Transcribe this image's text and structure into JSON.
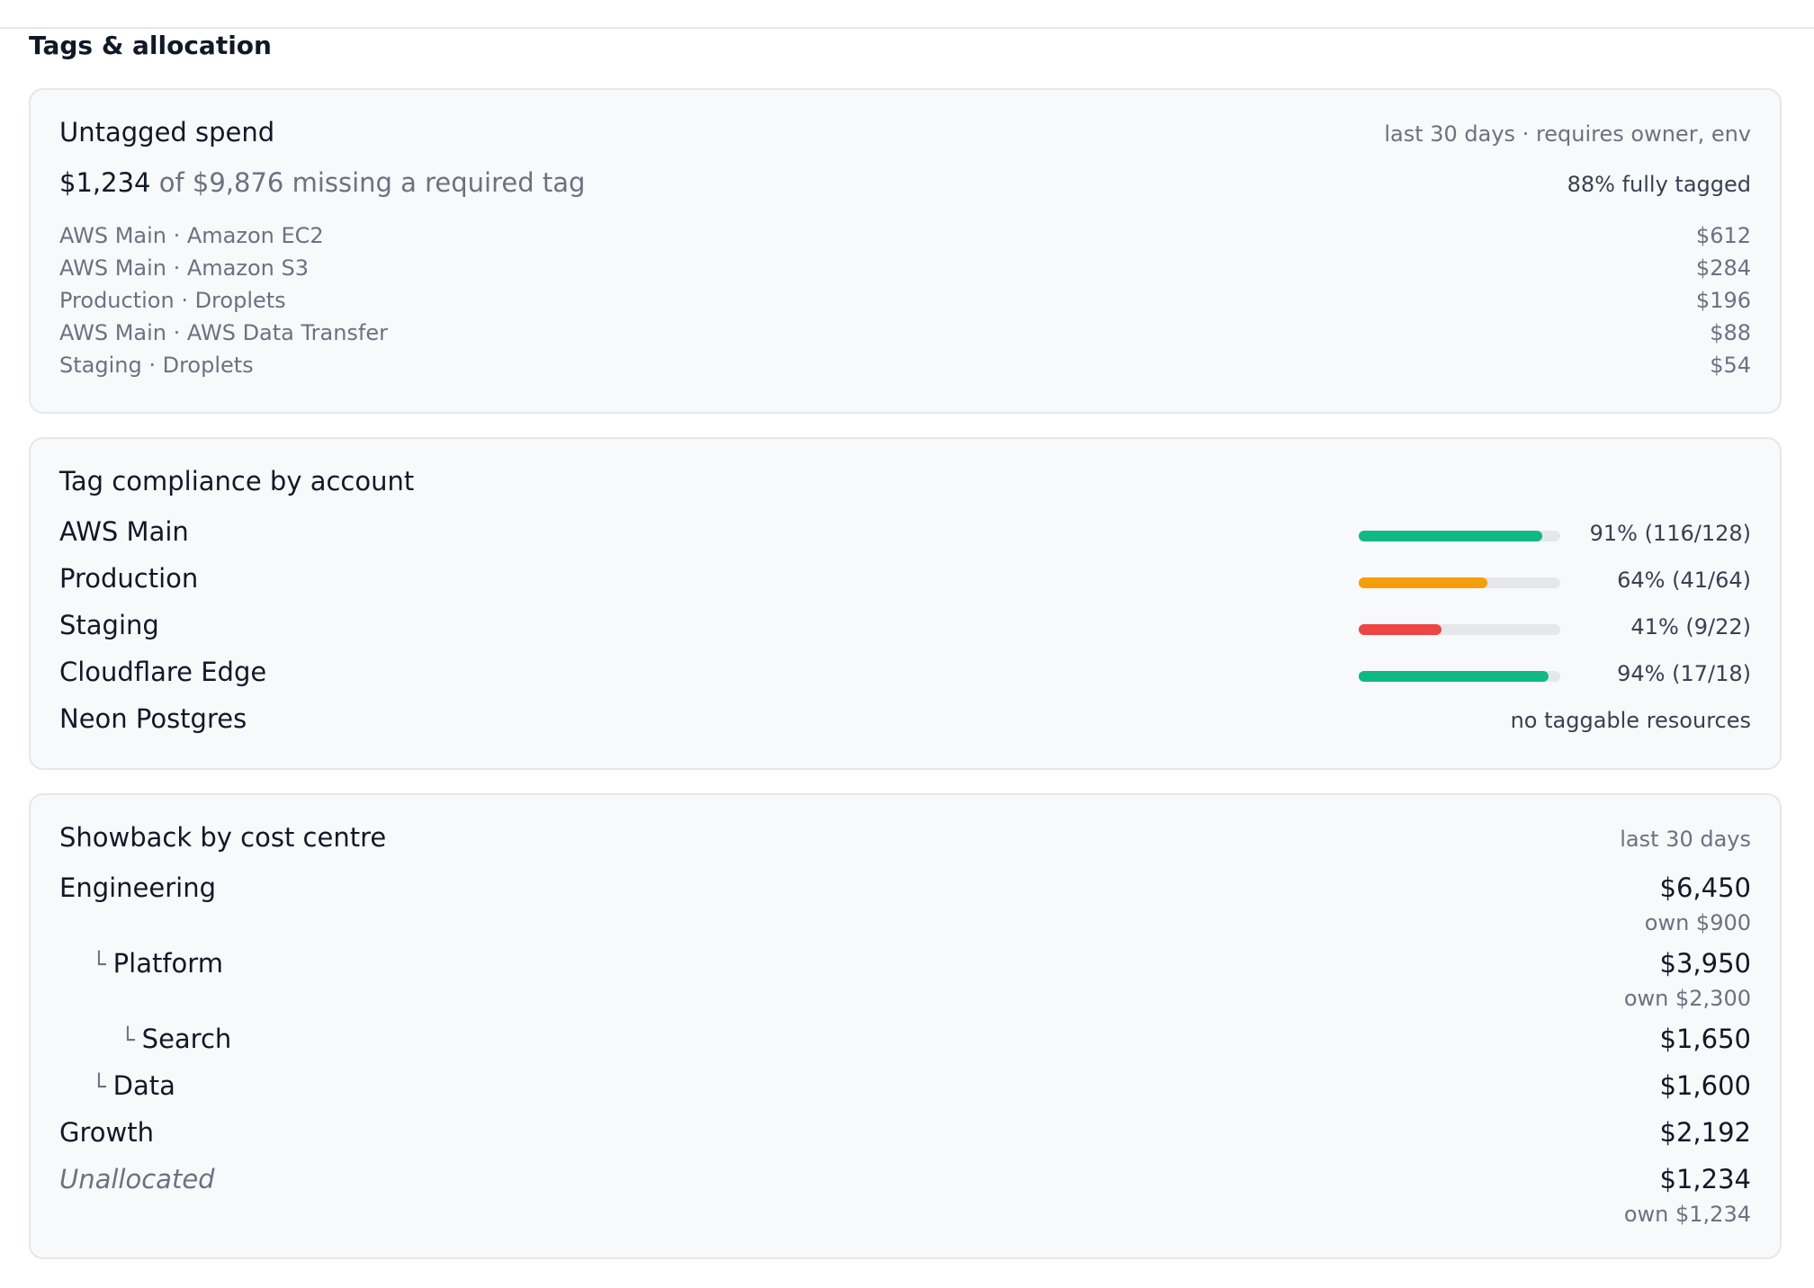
{
  "section_title": "Tags & allocation",
  "untagged": {
    "title": "Untagged spend",
    "meta": "last 30 days · requires owner, env",
    "summary_amount": "$1,234",
    "summary_rest": "of $9,876 missing a required tag",
    "tagged_pct": "88% fully tagged",
    "items": [
      {
        "label": "AWS Main · Amazon EC2",
        "value": "$612"
      },
      {
        "label": "AWS Main · Amazon S3",
        "value": "$284"
      },
      {
        "label": "Production · Droplets",
        "value": "$196"
      },
      {
        "label": "AWS Main · AWS Data Transfer",
        "value": "$88"
      },
      {
        "label": "Staging · Droplets",
        "value": "$54"
      }
    ]
  },
  "compliance": {
    "title": "Tag compliance by account",
    "accounts": [
      {
        "name": "AWS Main",
        "fraction": 0.91,
        "label": "91% (116/128)",
        "color": "#10b981"
      },
      {
        "name": "Production",
        "fraction": 0.64,
        "label": "64% (41/64)",
        "color": "#f59e0b"
      },
      {
        "name": "Staging",
        "fraction": 0.41,
        "label": "41% (9/22)",
        "color": "#ef4444"
      },
      {
        "name": "Cloudflare Edge",
        "fraction": 0.94,
        "label": "94% (17/18)",
        "color": "#10b981"
      },
      {
        "name": "Neon Postgres",
        "label": "no taggable resources"
      }
    ]
  },
  "showback": {
    "title": "Showback by cost centre",
    "meta": "last 30 days",
    "tree_glyph": "└",
    "rows": [
      {
        "name": "Engineering",
        "value": "$6,450",
        "own": "own $900"
      },
      {
        "name": "Platform",
        "value": "$3,950",
        "own": "own $2,300"
      },
      {
        "name": "Search",
        "value": "$1,650"
      },
      {
        "name": "Data",
        "value": "$1,600"
      },
      {
        "name": "Growth",
        "value": "$2,192"
      },
      {
        "name": "Unallocated",
        "value": "$1,234",
        "own": "own $1,234"
      }
    ]
  }
}
